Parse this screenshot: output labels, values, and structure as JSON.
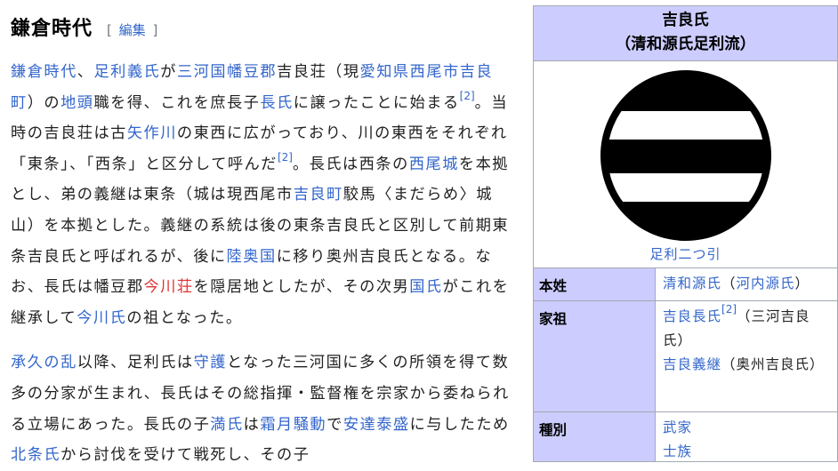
{
  "section": {
    "title": "鎌倉時代",
    "edit_open": "[",
    "edit_label": "編集",
    "edit_close": "]"
  },
  "paragraph1": {
    "s1": "鎌倉時代",
    "s2": "、",
    "s3": "足利義氏",
    "s4": "が",
    "s5": "三河国",
    "s6": "幡豆郡",
    "s7": "吉良荘（現",
    "s8": "愛知県",
    "s9": "西尾市",
    "s10": "吉良町",
    "s11": "）の",
    "s12": "地頭",
    "s13": "職を得、これを庶長子",
    "s14": "長氏",
    "s15": "に譲ったことに始まる",
    "ref1": "[2]",
    "s16": "。当時の吉良荘は古",
    "s17": "矢作川",
    "s18": "の東西に広がっており、川の東西をそれぞれ「東条」、「西条」と区分して呼んだ",
    "ref2": "[2]",
    "s19": "。長氏は西条の",
    "s20": "西尾城",
    "s21": "を本拠とし、弟の義継は東条（城は現西尾市",
    "s22": "吉良町",
    "s23": "駮馬〈まだらめ〉城山）を本拠とした。義継の系統は後の東条吉良氏と区別して前期東条吉良氏と呼ばれるが、後に",
    "s24": "陸奥国",
    "s25": "に移り奥州吉良氏となる。なお、長氏は幡豆郡",
    "s26": "今川荘",
    "s27": "を隠居地としたが、その次男",
    "s28": "国氏",
    "s29": "がこれを継承して",
    "s30": "今川氏",
    "s31": "の祖となった。"
  },
  "paragraph2": {
    "s1": "承久の乱",
    "s2": "以降、足利氏は",
    "s3": "守護",
    "s4": "となった三河国に多くの所領を得て数多の分家が生まれ、長氏はその総指揮・監督権を宗家から委ねられる立場にあった。長氏の子",
    "s5": "満氏",
    "s6": "は",
    "s7": "霜月騒動",
    "s8": "で",
    "s9": "安達泰盛",
    "s10": "に与したため",
    "s11": "北条氏",
    "s12": "から討伐を受けて戦死し、その子"
  },
  "infobox": {
    "title_line1": "吉良氏",
    "title_line2": "（清和源氏足利流）",
    "image_icon": "ashikaga-futatsubiki-crest",
    "caption": "足利二つ引",
    "honsei_label": "本姓",
    "honsei_link": "清和源氏",
    "honsei_paren_open": "（",
    "honsei_sub": "河内源氏",
    "honsei_paren_close": "）",
    "kaso_label": "家祖",
    "kaso1_link": "吉良長氏",
    "kaso1_ref": "[2]",
    "kaso1_note": "（三河吉良氏）",
    "kaso2_link": "吉良義継",
    "kaso2_note": "（奥州吉良氏）",
    "shubetsu_label": "種別",
    "shubetsu1": "武家",
    "shubetsu2": "士族"
  },
  "colors": {
    "link": "#3366cc",
    "redlink": "#d33",
    "infobox_header": "#ccccff",
    "text": "#202122"
  }
}
